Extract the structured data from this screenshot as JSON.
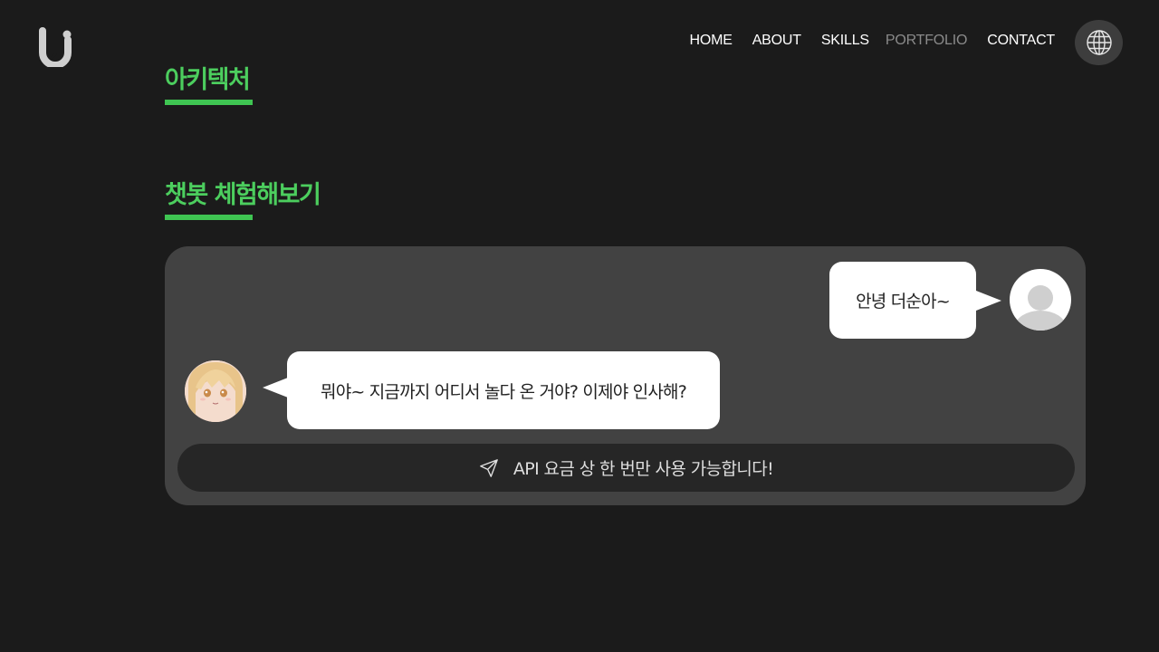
{
  "nav": {
    "items": [
      {
        "label": "HOME"
      },
      {
        "label": "ABOUT"
      },
      {
        "label": "SKILLS"
      },
      {
        "label": "PORTFOLIO",
        "active": true
      },
      {
        "label": "CONTACT"
      }
    ],
    "language_icon": "globe-icon",
    "active_color": "#8a8a8a"
  },
  "sections": {
    "architecture_title": "아키텍처",
    "chatbot_title": "챗봇 체험해보기",
    "accent_color": "#4cce5e"
  },
  "chat": {
    "messages": [
      {
        "sender": "user",
        "text": "안녕 더순아~"
      },
      {
        "sender": "bot",
        "text": "뭐야~ 지금까지 어디서 놀다 온 거야? 이제야 인사해?"
      }
    ],
    "input_notice": "API 요금 상 한 번만 사용 가능합니다!",
    "send_icon": "send-icon"
  }
}
